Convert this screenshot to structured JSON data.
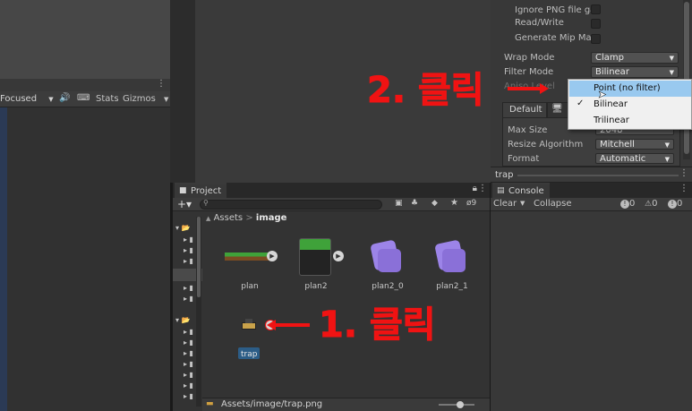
{
  "scene_toolbar": {
    "focused": "Focused",
    "stats": "Stats",
    "gizmos": "Gizmos"
  },
  "inspector": {
    "ignore_png": "Ignore PNG file gar",
    "read_write": "Read/Write",
    "gen_mip": "Generate Mip Map",
    "wrap_mode_label": "Wrap Mode",
    "wrap_mode_value": "Clamp",
    "filter_mode_label": "Filter Mode",
    "filter_mode_value": "Bilinear",
    "aniso_label": "Aniso Level",
    "default_tab": "Default",
    "max_size_label": "Max Size",
    "max_size_value": "2048",
    "resize_label": "Resize Algorithm",
    "resize_value": "Mitchell",
    "format_label": "Format",
    "format_value": "Automatic",
    "asset_name": "trap"
  },
  "filter_dropdown": {
    "options": [
      "Point (no filter)",
      "Bilinear",
      "Trilinear"
    ],
    "selected": "Bilinear",
    "highlighted": "Point (no filter)"
  },
  "project": {
    "tab": "Project",
    "breadcrumb_root": "Assets",
    "breadcrumb_sep": ">",
    "breadcrumb_current": "image",
    "hidden_count": "9",
    "assets": [
      {
        "name": "plan",
        "icon": "grass-platform-icon"
      },
      {
        "name": "plan2",
        "icon": "grass-block-icon"
      },
      {
        "name": "plan2_0",
        "icon": "sprite-icon"
      },
      {
        "name": "plan2_1",
        "icon": "sprite-icon"
      },
      {
        "name": "trap",
        "icon": "trap-sprite-icon"
      }
    ],
    "status_path": "Assets/image/trap.png"
  },
  "console": {
    "tab": "Console",
    "clear": "Clear",
    "collapse": "Collapse",
    "info_count": "0",
    "warn_count": "0",
    "error_count": "0"
  },
  "annotations": {
    "step1": "1. 클릭",
    "step2": "2. 클릭",
    "color": "#f01313"
  }
}
